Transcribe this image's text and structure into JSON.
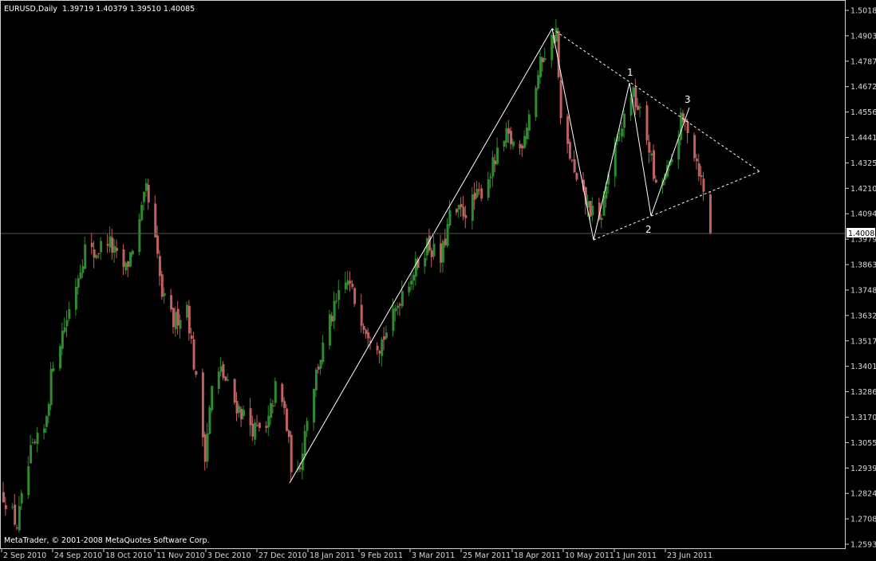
{
  "header": {
    "symbol": "EURUSD,Daily",
    "ohlc": "1.39719 1.40379 1.39510 1.40085"
  },
  "footer": {
    "copyright": "MetaTrader, © 2001-2008 MetaQuotes Software Corp."
  },
  "current_price": "1.40085",
  "colors": {
    "background": "#000000",
    "bull_candle": "#2e8b2e",
    "bear_candle": "#c06060",
    "axis": "#d0d0d0",
    "pattern_lines": "#ffffff"
  },
  "chart_data": {
    "type": "candlestick",
    "title": "",
    "y_axis_labels": [
      "1.50185",
      "1.49030",
      "1.47875",
      "1.46720",
      "1.45565",
      "1.44410",
      "1.43255",
      "1.42100",
      "1.40945",
      "1.39790",
      "1.38635",
      "1.37480",
      "1.36325",
      "1.35170",
      "1.34015",
      "1.32860",
      "1.31705",
      "1.30550",
      "1.29395",
      "1.28240",
      "1.27085",
      "1.25930"
    ],
    "x_axis_labels": [
      "2 Sep 2010",
      "24 Sep 2010",
      "18 Oct 2010",
      "11 Nov 2010",
      "3 Dec 2010",
      "27 Dec 2010",
      "18 Jan 2011",
      "9 Feb 2011",
      "3 Mar 2011",
      "25 Mar 2011",
      "18 Apr 2011",
      "10 May 2011",
      "1 Jun 2011",
      "23 Jun 2011"
    ],
    "ylim": [
      1.2593,
      1.50185
    ],
    "close_path": [
      [
        "2010-09-02",
        1.282
      ],
      [
        "2010-09-08",
        1.268
      ],
      [
        "2010-09-14",
        1.3
      ],
      [
        "2010-09-20",
        1.311
      ],
      [
        "2010-09-24",
        1.343
      ],
      [
        "2010-09-30",
        1.362
      ],
      [
        "2010-10-04",
        1.378
      ],
      [
        "2010-10-08",
        1.394
      ],
      [
        "2010-10-12",
        1.391
      ],
      [
        "2010-10-18",
        1.398
      ],
      [
        "2010-10-22",
        1.389
      ],
      [
        "2010-10-26",
        1.384
      ],
      [
        "2010-11-01",
        1.405
      ],
      [
        "2010-11-04",
        1.42
      ],
      [
        "2010-11-08",
        1.396
      ],
      [
        "2010-11-11",
        1.372
      ],
      [
        "2010-11-16",
        1.36
      ],
      [
        "2010-11-22",
        1.368
      ],
      [
        "2010-11-26",
        1.333
      ],
      [
        "2010-11-30",
        1.301
      ],
      [
        "2010-12-03",
        1.33
      ],
      [
        "2010-12-07",
        1.338
      ],
      [
        "2010-12-13",
        1.324
      ],
      [
        "2010-12-17",
        1.318
      ],
      [
        "2010-12-22",
        1.311
      ],
      [
        "2010-12-27",
        1.31
      ],
      [
        "2010-12-31",
        1.33
      ],
      [
        "2011-01-04",
        1.32
      ],
      [
        "2011-01-07",
        1.296
      ],
      [
        "2011-01-10",
        1.29
      ],
      [
        "2011-01-14",
        1.318
      ],
      [
        "2011-01-18",
        1.337
      ],
      [
        "2011-01-24",
        1.36
      ],
      [
        "2011-01-28",
        1.371
      ],
      [
        "2011-02-01",
        1.379
      ],
      [
        "2011-02-04",
        1.37
      ],
      [
        "2011-02-09",
        1.358
      ],
      [
        "2011-02-15",
        1.35
      ],
      [
        "2011-02-21",
        1.362
      ],
      [
        "2011-02-25",
        1.375
      ],
      [
        "2011-03-03",
        1.385
      ],
      [
        "2011-03-08",
        1.396
      ],
      [
        "2011-03-14",
        1.388
      ],
      [
        "2011-03-18",
        1.408
      ],
      [
        "2011-03-25",
        1.411
      ],
      [
        "2011-03-31",
        1.418
      ],
      [
        "2011-04-06",
        1.431
      ],
      [
        "2011-04-12",
        1.444
      ],
      [
        "2011-04-18",
        1.439
      ],
      [
        "2011-04-22",
        1.455
      ],
      [
        "2011-04-28",
        1.481
      ],
      [
        "2011-05-04",
        1.492
      ],
      [
        "2011-05-06",
        1.45
      ],
      [
        "2011-05-10",
        1.436
      ],
      [
        "2011-05-13",
        1.422
      ],
      [
        "2011-05-18",
        1.413
      ],
      [
        "2011-05-23",
        1.404
      ],
      [
        "2011-05-27",
        1.428
      ],
      [
        "2011-06-01",
        1.445
      ],
      [
        "2011-06-06",
        1.465
      ],
      [
        "2011-06-09",
        1.458
      ],
      [
        "2011-06-14",
        1.44
      ],
      [
        "2011-06-17",
        1.42
      ],
      [
        "2011-06-20",
        1.425
      ],
      [
        "2011-06-23",
        1.43
      ],
      [
        "2011-06-28",
        1.451
      ],
      [
        "2011-07-01",
        1.449
      ],
      [
        "2011-07-06",
        1.43
      ],
      [
        "2011-07-11",
        1.402
      ]
    ],
    "annotations": [
      "1",
      "2",
      "3"
    ]
  }
}
